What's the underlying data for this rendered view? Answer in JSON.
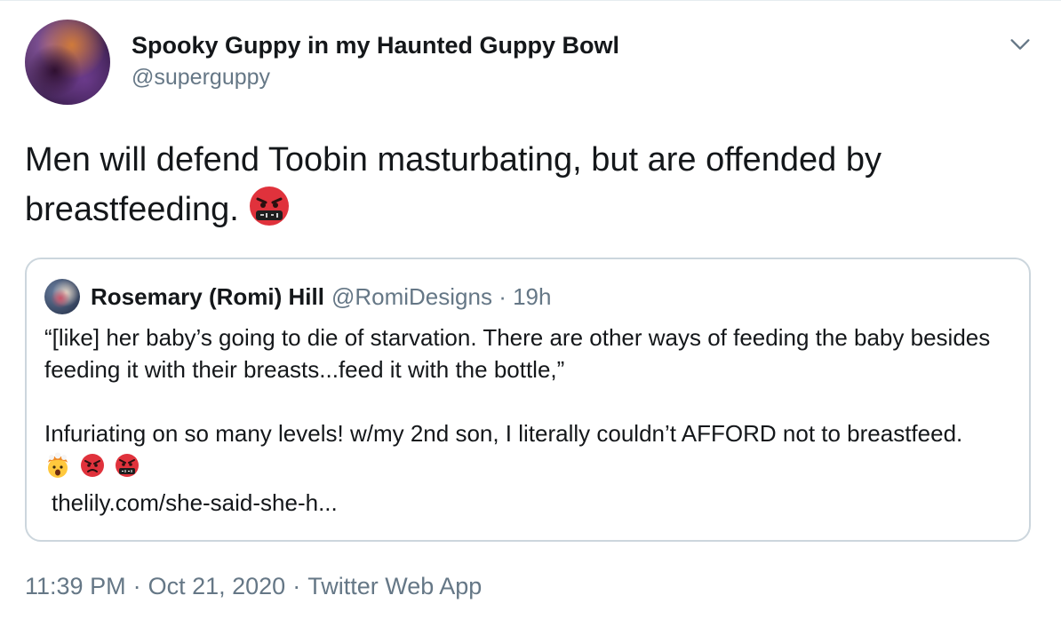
{
  "author": {
    "display_name": "Spooky Guppy in my Haunted Guppy Bowl",
    "handle": "@superguppy"
  },
  "menu": {
    "icon": "chevron-down-icon"
  },
  "tweet": {
    "text": "Men will defend Toobin masturbating, but are offended by breastfeeding.",
    "emoji": "cursing-face-emoji"
  },
  "quote": {
    "author_name": "Rosemary (Romi) Hill",
    "author_handle": "@RomiDesigns",
    "separator": "·",
    "time_ago": "19h",
    "paragraph_1": "“[like] her baby’s going to die of starvation. There are other ways of feeding the baby besides feeding it with their breasts...feed it with the bottle,”",
    "paragraph_2": "Infuriating on so many levels! w/my 2nd son, I literally couldn’t AFFORD not to breastfeed.",
    "emojis": [
      "exploding-head-emoji",
      "angry-face-emoji",
      "cursing-face-emoji"
    ],
    "link": "thelily.com/she-said-she-h..."
  },
  "footer": {
    "time": "11:39 PM",
    "separator": "·",
    "date": "Oct 21, 2020",
    "source": "Twitter Web App"
  },
  "colors": {
    "text": "#14171a",
    "secondary": "#657786",
    "border": "#ccd6dd",
    "emoji_red": "#e0323c"
  }
}
